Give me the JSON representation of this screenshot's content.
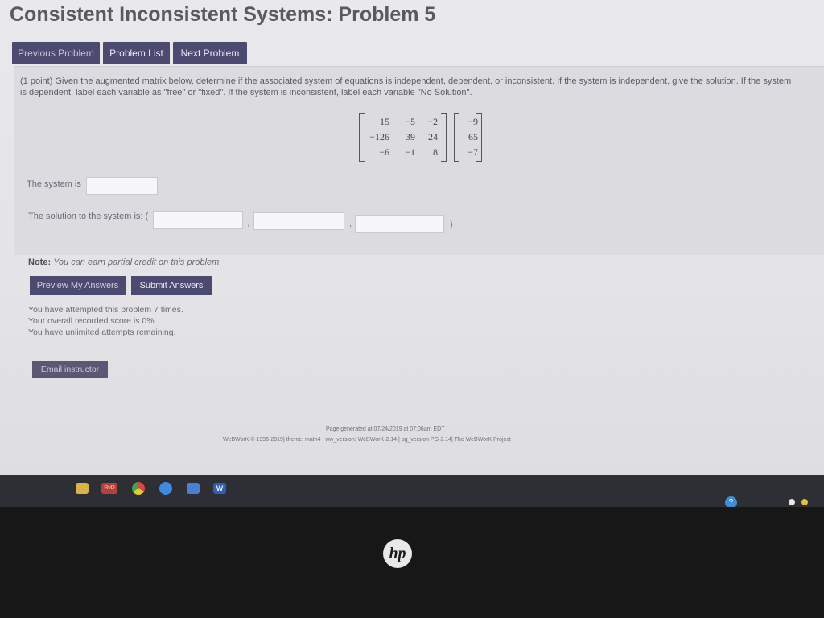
{
  "page": {
    "title": "Consistent Inconsistent Systems: Problem 5"
  },
  "nav": {
    "previous": "Previous Problem",
    "list": "Problem List",
    "next": "Next Problem"
  },
  "problem": {
    "line1": "(1 point) Given the augmented matrix below, determine if the associated system of equations is independent, dependent, or inconsistent. If the system is independent, give the solution. If the system",
    "line2": "is dependent, label each variable as \"free\" or \"fixed\". If the system is inconsistent, label each variable \"No Solution\".",
    "matrix": [
      [
        "15",
        "−5",
        "−2"
      ],
      [
        "−126",
        "39",
        "24"
      ],
      [
        "−6",
        "−1",
        "8"
      ]
    ],
    "augment": [
      "−9",
      "65",
      "−7"
    ],
    "system_label": "The system is",
    "system_value": "",
    "solution_label": "The solution to the system is: (",
    "solution_values": [
      "",
      "",
      ""
    ],
    "comma": ",",
    "close_paren": ")"
  },
  "note": {
    "bold": "Note:",
    "text": "You can earn partial credit on this problem."
  },
  "actions": {
    "preview": "Preview My Answers",
    "submit": "Submit Answers"
  },
  "status": {
    "attempts": "You have attempted this problem 7 times.",
    "score": "Your overall recorded score is 0%.",
    "remaining": "You have unlimited attempts remaining."
  },
  "email_label": "Email instructor",
  "footer": {
    "generated": "Page generated at 07/24/2019 at 07:06am EDT",
    "credits": "WeBWorK © 1996-2019| theme: math4 | ww_version: WeBWorK-2.14 | pg_version PG-2.14| The WeBWorK Project"
  },
  "taskbar": {
    "icons": [
      "file-explorer-icon",
      "rvd-app-icon",
      "chrome-icon",
      "edge-icon",
      "mail-icon",
      "word-icon"
    ],
    "rvd_label": "RvD",
    "word_label": "W",
    "tray_help": "?"
  },
  "device": {
    "logo": "hp"
  },
  "colors": {
    "accent_button": "#4d4a72",
    "panel": "#dcdbe0",
    "background": "#e6e5e8"
  }
}
